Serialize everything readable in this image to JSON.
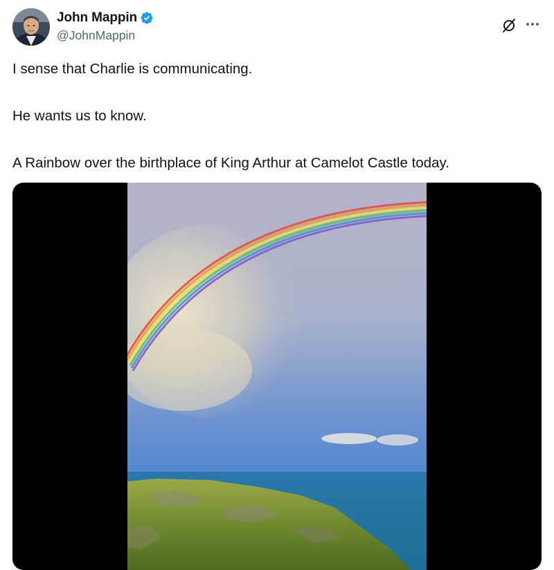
{
  "author": {
    "display_name": "John Mappin",
    "handle": "@JohnMappin",
    "verified": true
  },
  "tweet": {
    "paragraphs": [
      "I sense that Charlie is communicating.",
      "He wants us to know.",
      "A Rainbow over the birthplace of King Arthur at Camelot Castle today."
    ]
  },
  "media": {
    "type": "photo",
    "subject": "rainbow-over-coastal-cliff"
  },
  "icons": {
    "verified": "verified-badge-icon",
    "grok": "grok-icon",
    "more": "more-options-icon"
  },
  "colors": {
    "text_primary": "#0f1419",
    "text_secondary": "#536471",
    "verified_blue": "#1d9bf0",
    "media_background": "#000000"
  }
}
